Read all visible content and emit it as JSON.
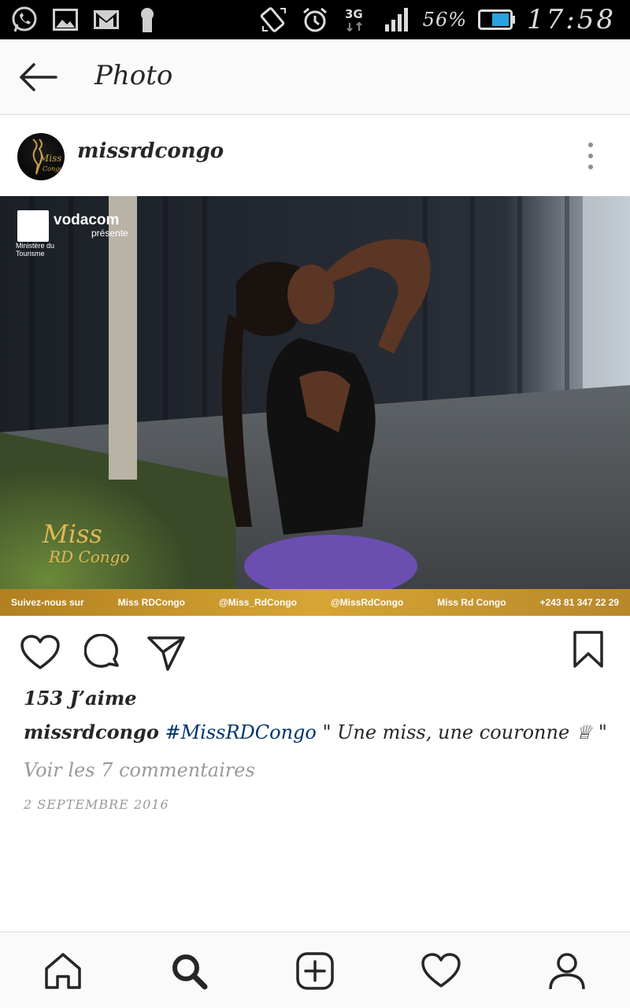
{
  "status_bar": {
    "left_icons": [
      "whatsapp-icon",
      "image-icon",
      "gmail-icon",
      "keyhole-icon"
    ],
    "right_icons": [
      "screen-rotation-icon",
      "alarm-icon",
      "network-3g-icon",
      "signal-icon"
    ],
    "network_type": "3G",
    "battery_percent": "56%",
    "time": "17:58"
  },
  "header": {
    "title": "Photo",
    "back_icon": "arrow-left-icon"
  },
  "post": {
    "username": "missrdcongo",
    "avatar_text": "Miss",
    "image": {
      "sponsor": "vodacom",
      "sponsor_sub": "présente",
      "ministry": "Ministère du Tourisme",
      "logo_miss": "Miss",
      "logo_rdcongo": "RD Congo",
      "banner": [
        "Suivez-nous sur",
        "Miss RDCongo",
        "@Miss_RdCongo",
        "@MissRdCongo",
        "Miss Rd Congo",
        "+243 81 347 22 29"
      ]
    },
    "likes": "153 J’aime",
    "caption_user": "missrdcongo",
    "caption_tag": "#MissRDCongo",
    "caption_text": " \" Une miss, une couronne ♕ \"",
    "view_comments": "Voir les 7 commentaires",
    "date": "2 SEPTEMBRE 2016"
  },
  "bottom_nav": [
    "home-icon",
    "search-icon",
    "add-post-icon",
    "activity-heart-icon",
    "profile-icon"
  ],
  "colors": {
    "status_bar_bg": "#000000",
    "header_bg": "#fafafa",
    "hashtag": "#003569",
    "muted_text": "#999999",
    "banner_gold": "#c9962b",
    "battery_fill": "#29a3e0"
  }
}
